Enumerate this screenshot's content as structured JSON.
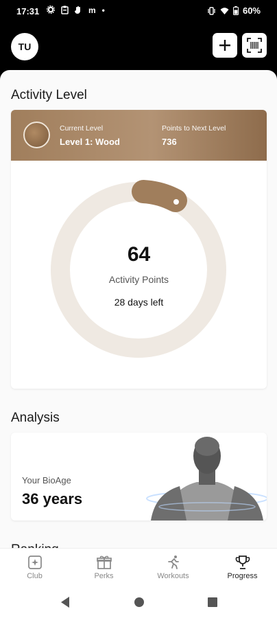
{
  "status_bar": {
    "time": "17:31",
    "left_icons": [
      "settings-icon",
      "clipboard-icon",
      "hand-icon",
      "m-icon",
      "dot"
    ],
    "m_glyph": "m",
    "dot_glyph": "•",
    "battery": "60%"
  },
  "header": {
    "avatar_initials": "TU"
  },
  "activity": {
    "section_title": "Activity Level",
    "current_level_caption": "Current Level",
    "current_level_value": "Level 1: Wood",
    "points_next_caption": "Points to Next Level",
    "points_next_value": "736",
    "points": "64",
    "points_label": "Activity Points",
    "days_left": "28 days left",
    "colors": {
      "accent": "#a07e5c",
      "track": "#efe9e2"
    }
  },
  "analysis": {
    "section_title": "Analysis",
    "bioage_label": "Your BioAge",
    "bioage_value": "36 years"
  },
  "ranking": {
    "section_title_partial": "Ranking"
  },
  "bottom_nav": {
    "items": [
      {
        "label": "Club",
        "icon": "club-icon"
      },
      {
        "label": "Perks",
        "icon": "gift-icon"
      },
      {
        "label": "Workouts",
        "icon": "runner-icon"
      },
      {
        "label": "Progress",
        "icon": "trophy-icon"
      }
    ],
    "active": "Progress"
  }
}
